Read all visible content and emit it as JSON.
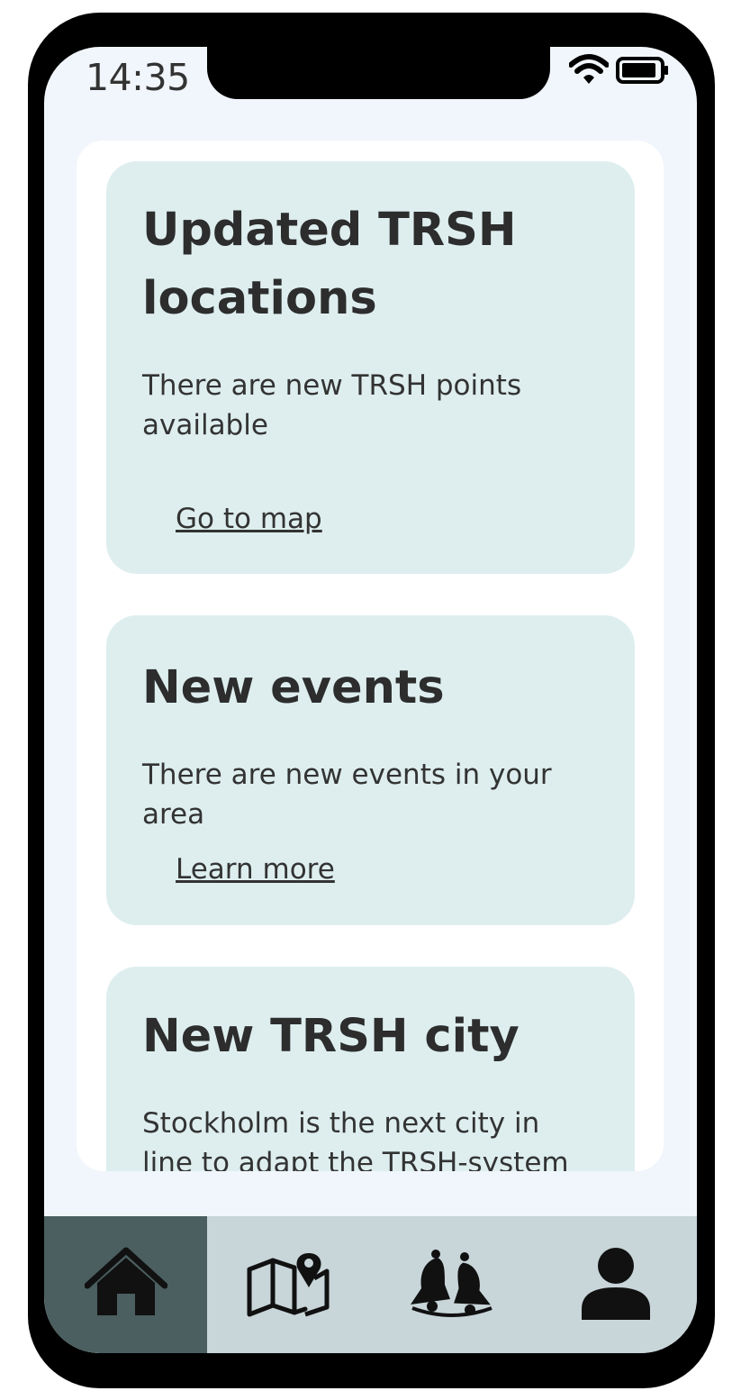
{
  "status_bar": {
    "time": "14:35"
  },
  "cards": [
    {
      "title": "Updated TRSH locations",
      "body": "There are new TRSH points available",
      "link": "Go to map"
    },
    {
      "title": "New events",
      "body": "There are new events in your area",
      "link": "Learn more"
    },
    {
      "title": "New TRSH city",
      "body": "Stockholm is the next city in line to adapt the TRSH-system"
    }
  ],
  "nav": {
    "items": [
      {
        "icon": "home-icon",
        "active": true
      },
      {
        "icon": "map-icon",
        "active": false
      },
      {
        "icon": "bells-icon",
        "active": false
      },
      {
        "icon": "user-icon",
        "active": false
      }
    ]
  },
  "colors": {
    "card_bg": "#deeeef",
    "screen_bg": "#f1f6fc",
    "nav_bg": "#c8d5d9",
    "nav_active_bg": "#4b5e60"
  }
}
